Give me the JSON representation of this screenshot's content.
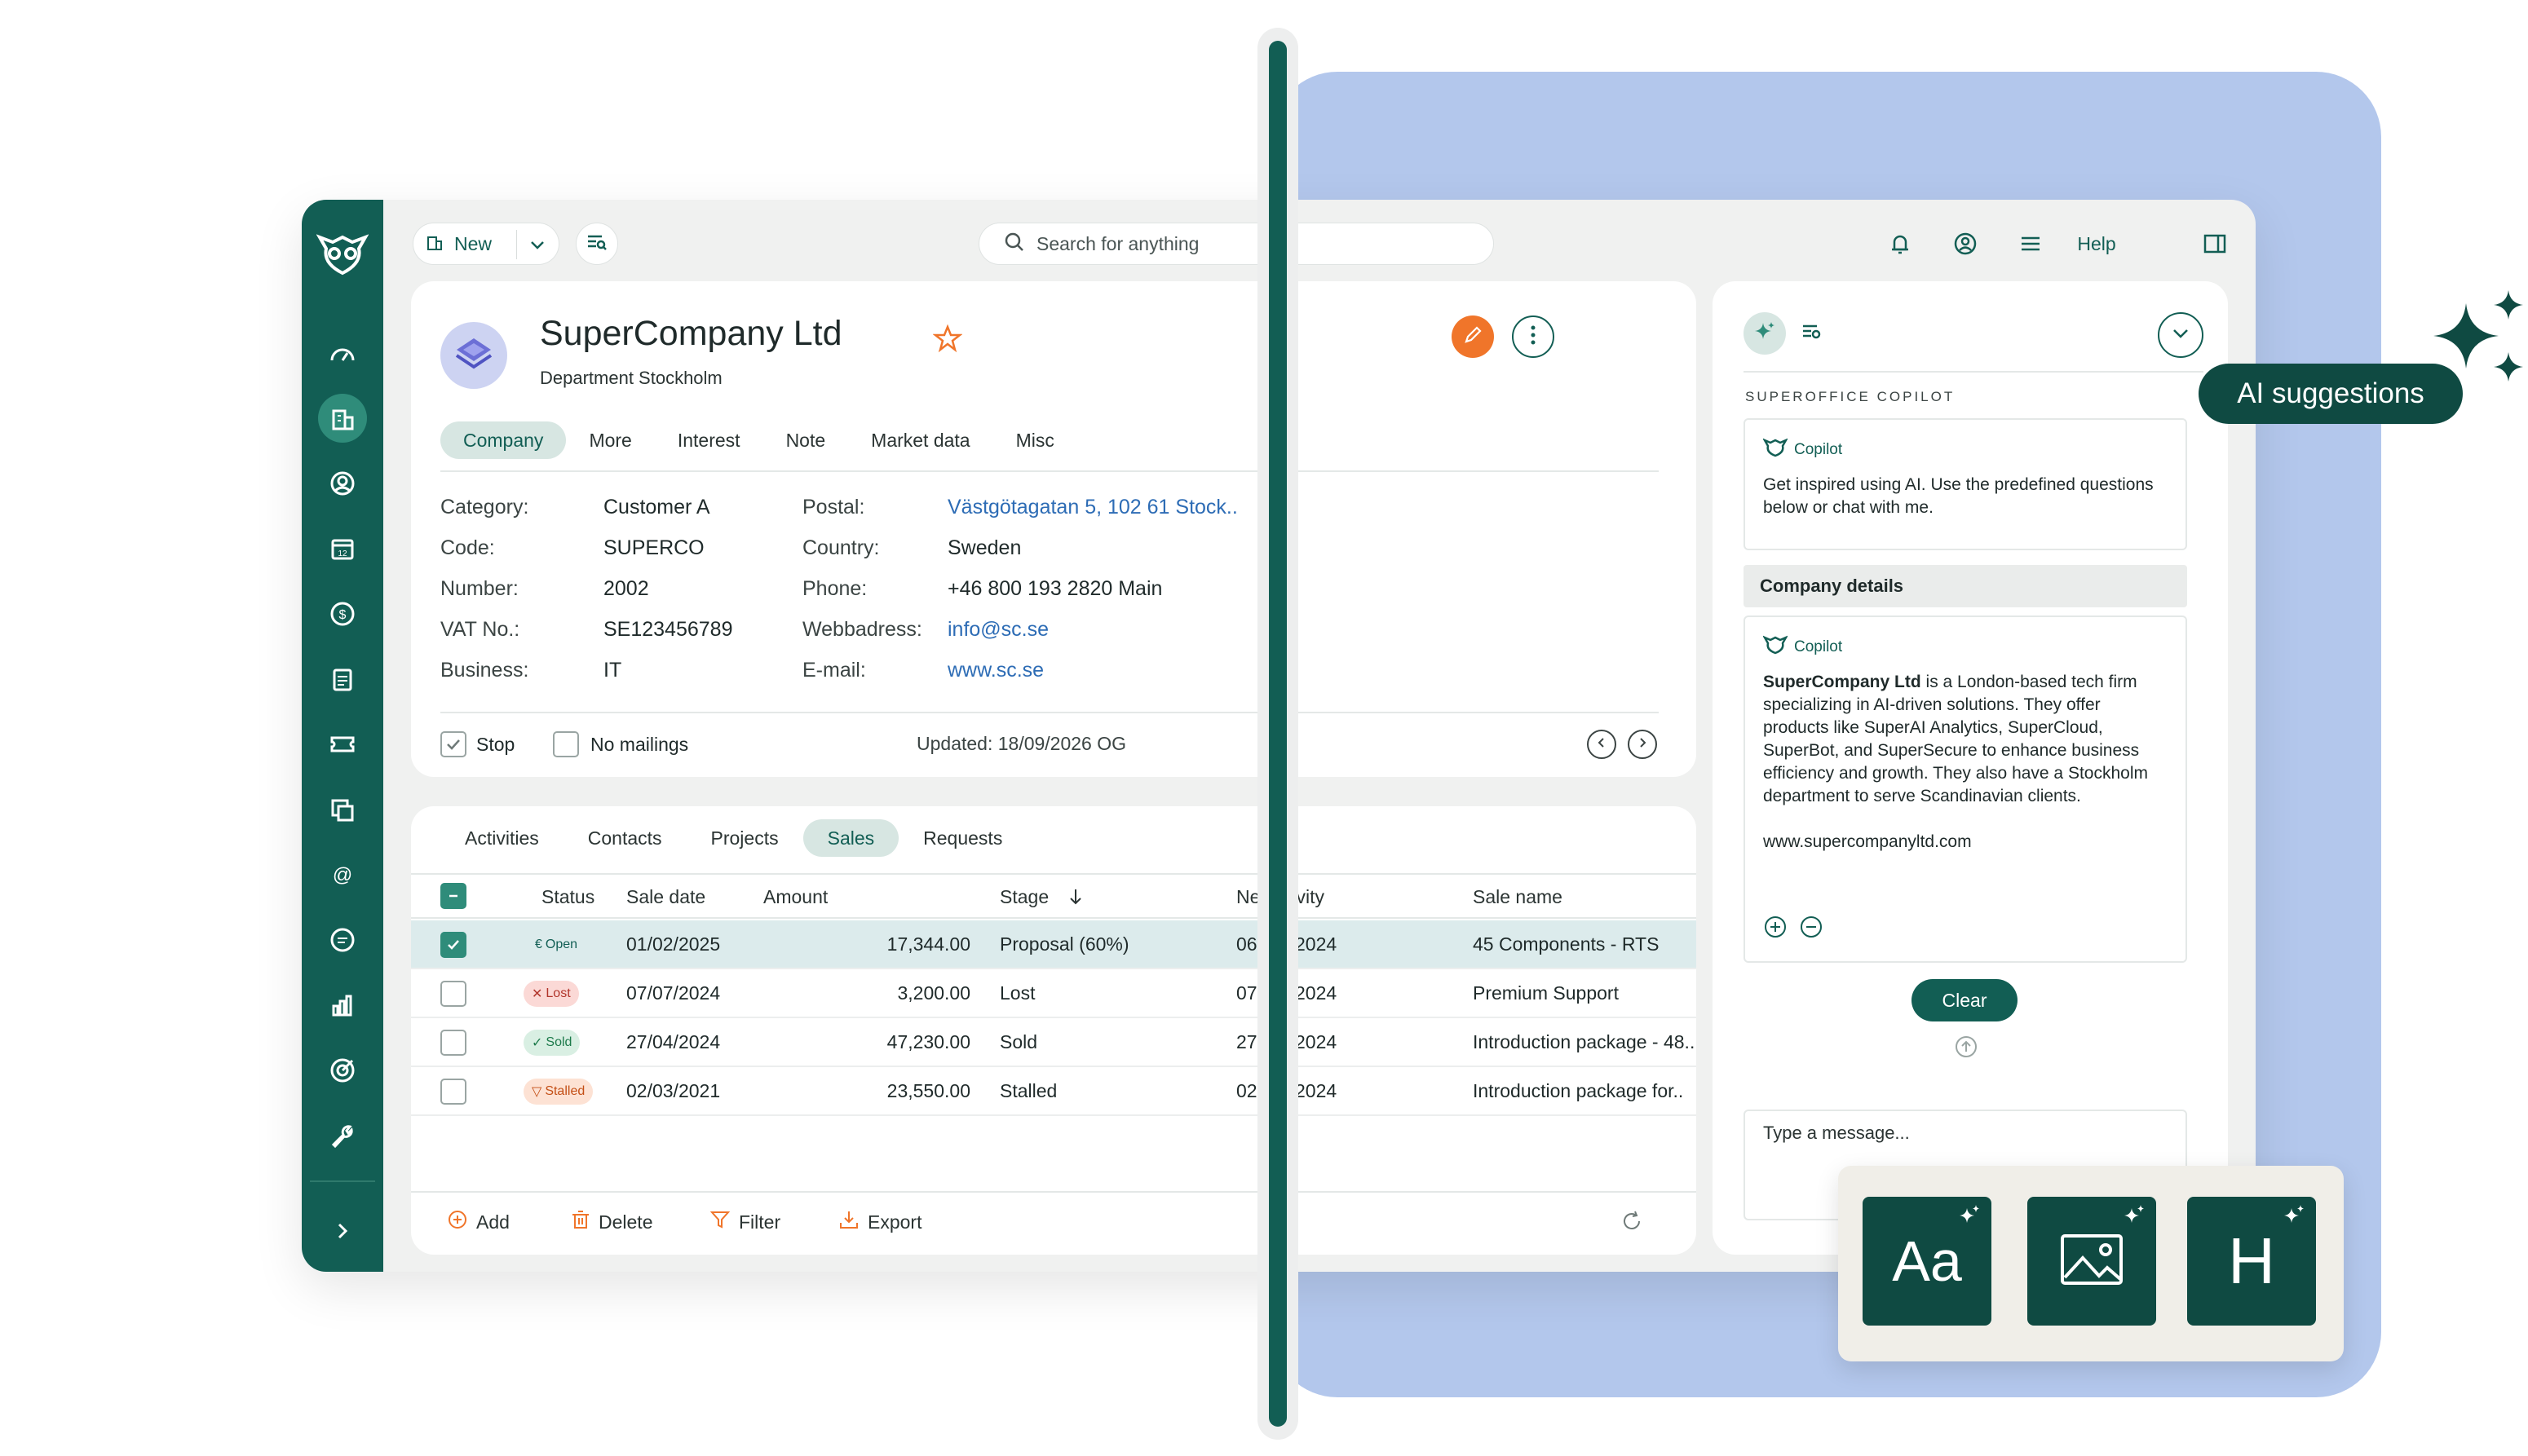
{
  "toolbar": {
    "new_label": "New",
    "search_placeholder": "Search for anything",
    "help_label": "Help"
  },
  "company": {
    "name": "SuperCompany Ltd",
    "department": "Department Stockholm",
    "tabs": [
      "Company",
      "More",
      "Interest",
      "Note",
      "Market data",
      "Misc"
    ],
    "active_tab": "Company",
    "left_fields": [
      {
        "label": "Category:",
        "value": "Customer A"
      },
      {
        "label": "Code:",
        "value": "SUPERCO"
      },
      {
        "label": "Number:",
        "value": "2002"
      },
      {
        "label": "VAT No.:",
        "value": "SE123456789"
      },
      {
        "label": "Business:",
        "value": "IT"
      }
    ],
    "right_fields": [
      {
        "label": "Postal:",
        "value": "Västgötagatan 5, 102 61 Stock..",
        "link": true
      },
      {
        "label": "Country:",
        "value": "Sweden",
        "link": false
      },
      {
        "label": "Phone:",
        "value": "+46 800 193 2820  Main",
        "link": false
      },
      {
        "label": "Webbadress:",
        "value": "info@sc.se",
        "link": true
      },
      {
        "label": "E-mail:",
        "value": "www.sc.se",
        "link": true
      }
    ],
    "stop_label": "Stop",
    "stop_checked": true,
    "no_mailings_label": "No mailings",
    "no_mailings_checked": false,
    "updated": "Updated: 18/09/2026 OG"
  },
  "sales": {
    "tabs": [
      "Activities",
      "Contacts",
      "Projects",
      "Sales",
      "Requests"
    ],
    "active_tab": "Sales",
    "columns": [
      "Status",
      "Sale date",
      "Amount",
      "Stage",
      "Ne",
      "tivity",
      "Sale name"
    ],
    "rows": [
      {
        "selected": true,
        "status": "Open",
        "status_kind": "open",
        "date": "01/02/2025",
        "amount": "17,344.00",
        "stage": "Proposal (60%)",
        "next": "06",
        "activity": "2024",
        "name": "45 Components - RTS"
      },
      {
        "selected": false,
        "status": "Lost",
        "status_kind": "lost",
        "date": "07/07/2024",
        "amount": "3,200.00",
        "stage": "Lost",
        "next": "07",
        "activity": "2024",
        "name": "Premium Support"
      },
      {
        "selected": false,
        "status": "Sold",
        "status_kind": "sold",
        "date": "27/04/2024",
        "amount": "47,230.00",
        "stage": "Sold",
        "next": "27",
        "activity": "2024",
        "name": "Introduction package - 48.."
      },
      {
        "selected": false,
        "status": "Stalled",
        "status_kind": "stalled",
        "date": "02/03/2021",
        "amount": "23,550.00",
        "stage": "Stalled",
        "next": "02",
        "activity": "2024",
        "name": "Introduction package for.."
      }
    ],
    "footer": {
      "add": "Add",
      "delete": "Delete",
      "filter": "Filter",
      "export": "Export"
    }
  },
  "copilot": {
    "title": "SUPEROFFICE COPILOT",
    "sender": "Copilot",
    "intro": "Get inspired using AI. Use the predefined questions below or chat with me.",
    "section": "Company details",
    "answer_bold": "SuperCompany Ltd",
    "answer_rest": " is a London-based tech firm specializing in AI-driven solutions. They offer products like SuperAI Analytics, SuperCloud, SuperBot, and SuperSecure to enhance business efficiency and growth. They also have a Stockholm department to serve Scandinavian clients.",
    "answer_url": "www.supercompanyltd.com",
    "clear_label": "Clear",
    "message_placeholder": "Type a message..."
  },
  "ai_suggestions_label": "AI suggestions",
  "tiles": {
    "text_tile": "Aa",
    "heading_tile": "H"
  },
  "colors": {
    "brand": "#125e54",
    "accent": "#f0752a",
    "link": "#2d6cb5",
    "background_card": "#b3c7ec"
  }
}
